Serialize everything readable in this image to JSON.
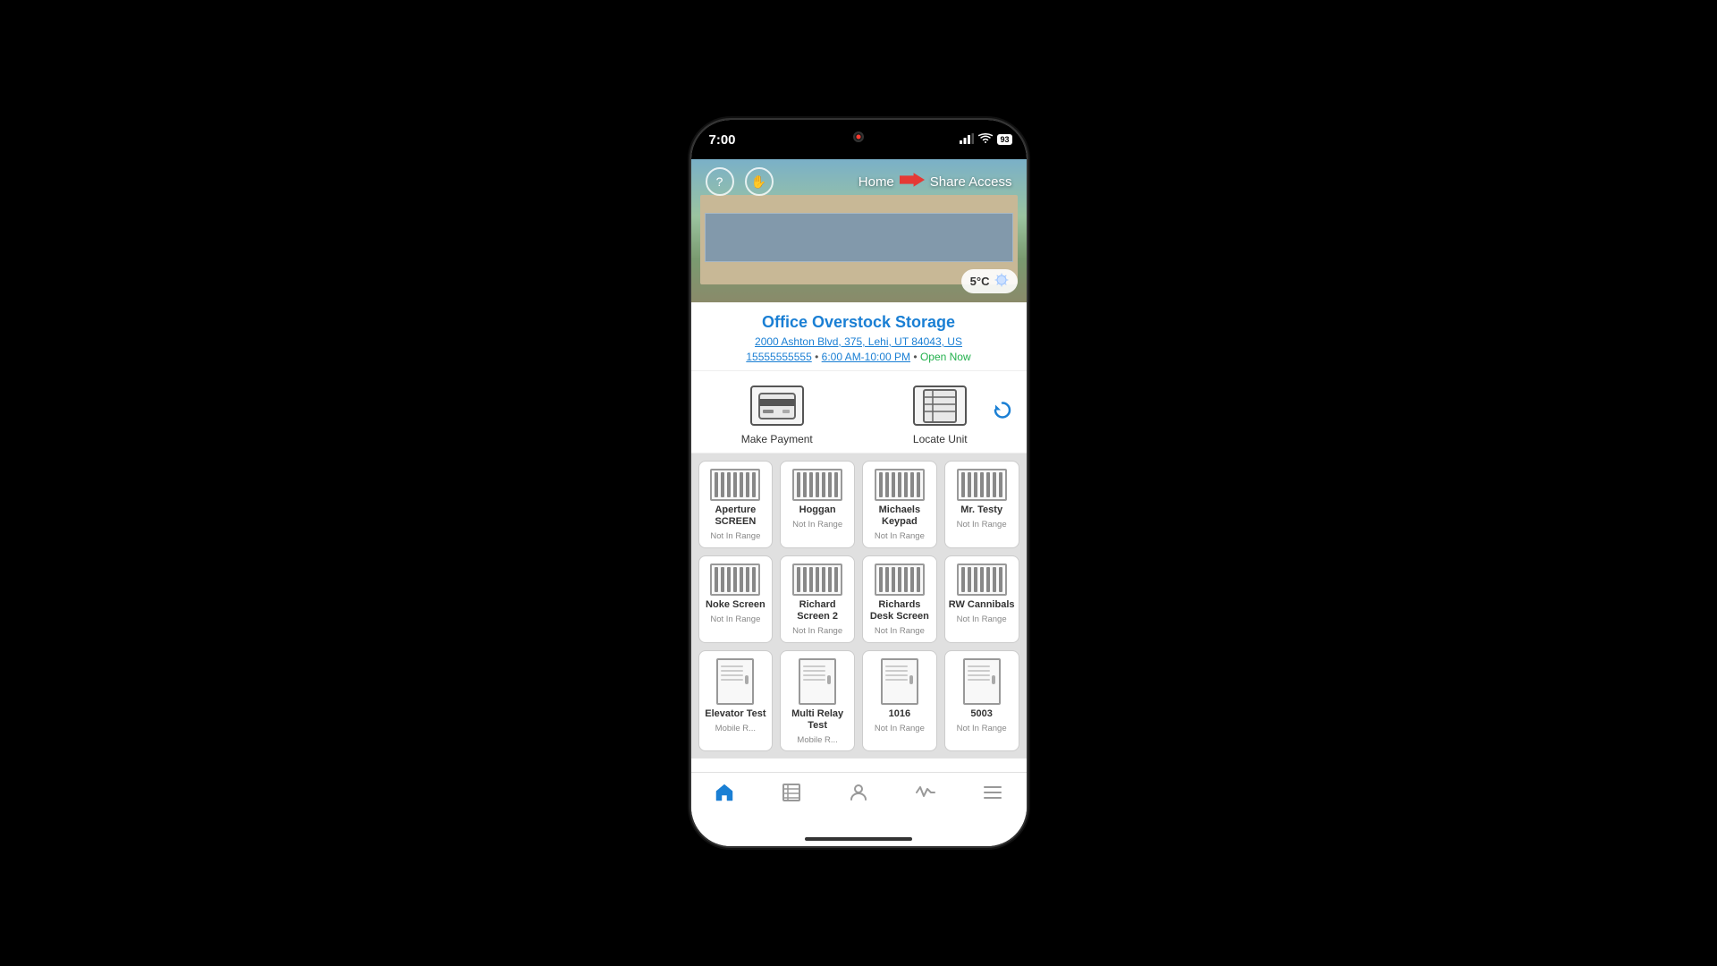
{
  "statusBar": {
    "time": "7:00",
    "battery": "93",
    "signal": "●●●",
    "wifi": "wifi"
  },
  "nav": {
    "home": "Home",
    "shareAccess": "Share Access"
  },
  "weather": {
    "temp": "5°C"
  },
  "location": {
    "name": "Office Overstock Storage",
    "address": "2000 Ashton Blvd, 375, Lehi, UT 84043, US",
    "phone": "15555555555",
    "hours": "6:00 AM-10:00 PM",
    "openStatus": "Open Now",
    "separator": " • "
  },
  "actions": {
    "makePayment": "Make Payment",
    "locateUnit": "Locate Unit"
  },
  "devices": [
    {
      "name": "Aperture SCREEN",
      "status": "Not In Range",
      "type": "gate"
    },
    {
      "name": "Hoggan",
      "status": "Not In Range",
      "type": "gate"
    },
    {
      "name": "Michaels Keypad",
      "status": "Not In Range",
      "type": "gate"
    },
    {
      "name": "Mr. Testy",
      "status": "Not In Range",
      "type": "gate"
    },
    {
      "name": "Noke Screen",
      "status": "Not In Range",
      "type": "gate"
    },
    {
      "name": "Richard Screen 2",
      "status": "Not In Range",
      "type": "gate"
    },
    {
      "name": "Richards Desk Screen",
      "status": "Not In Range",
      "type": "gate"
    },
    {
      "name": "RW Cannibals",
      "status": "Not In Range",
      "type": "gate"
    },
    {
      "name": "Elevator Test",
      "status": "Mobile R...",
      "type": "door"
    },
    {
      "name": "Multi Relay Test",
      "status": "Mobile R...",
      "type": "door"
    },
    {
      "name": "1016",
      "status": "Not In Range",
      "type": "door"
    },
    {
      "name": "5003",
      "status": "Not In Range",
      "type": "door"
    }
  ],
  "tabs": [
    {
      "label": "Home",
      "icon": "home",
      "active": true
    },
    {
      "label": "Units",
      "icon": "units",
      "active": false
    },
    {
      "label": "Account",
      "icon": "account",
      "active": false
    },
    {
      "label": "Activity",
      "icon": "activity",
      "active": false
    },
    {
      "label": "More",
      "icon": "more",
      "active": false
    }
  ]
}
